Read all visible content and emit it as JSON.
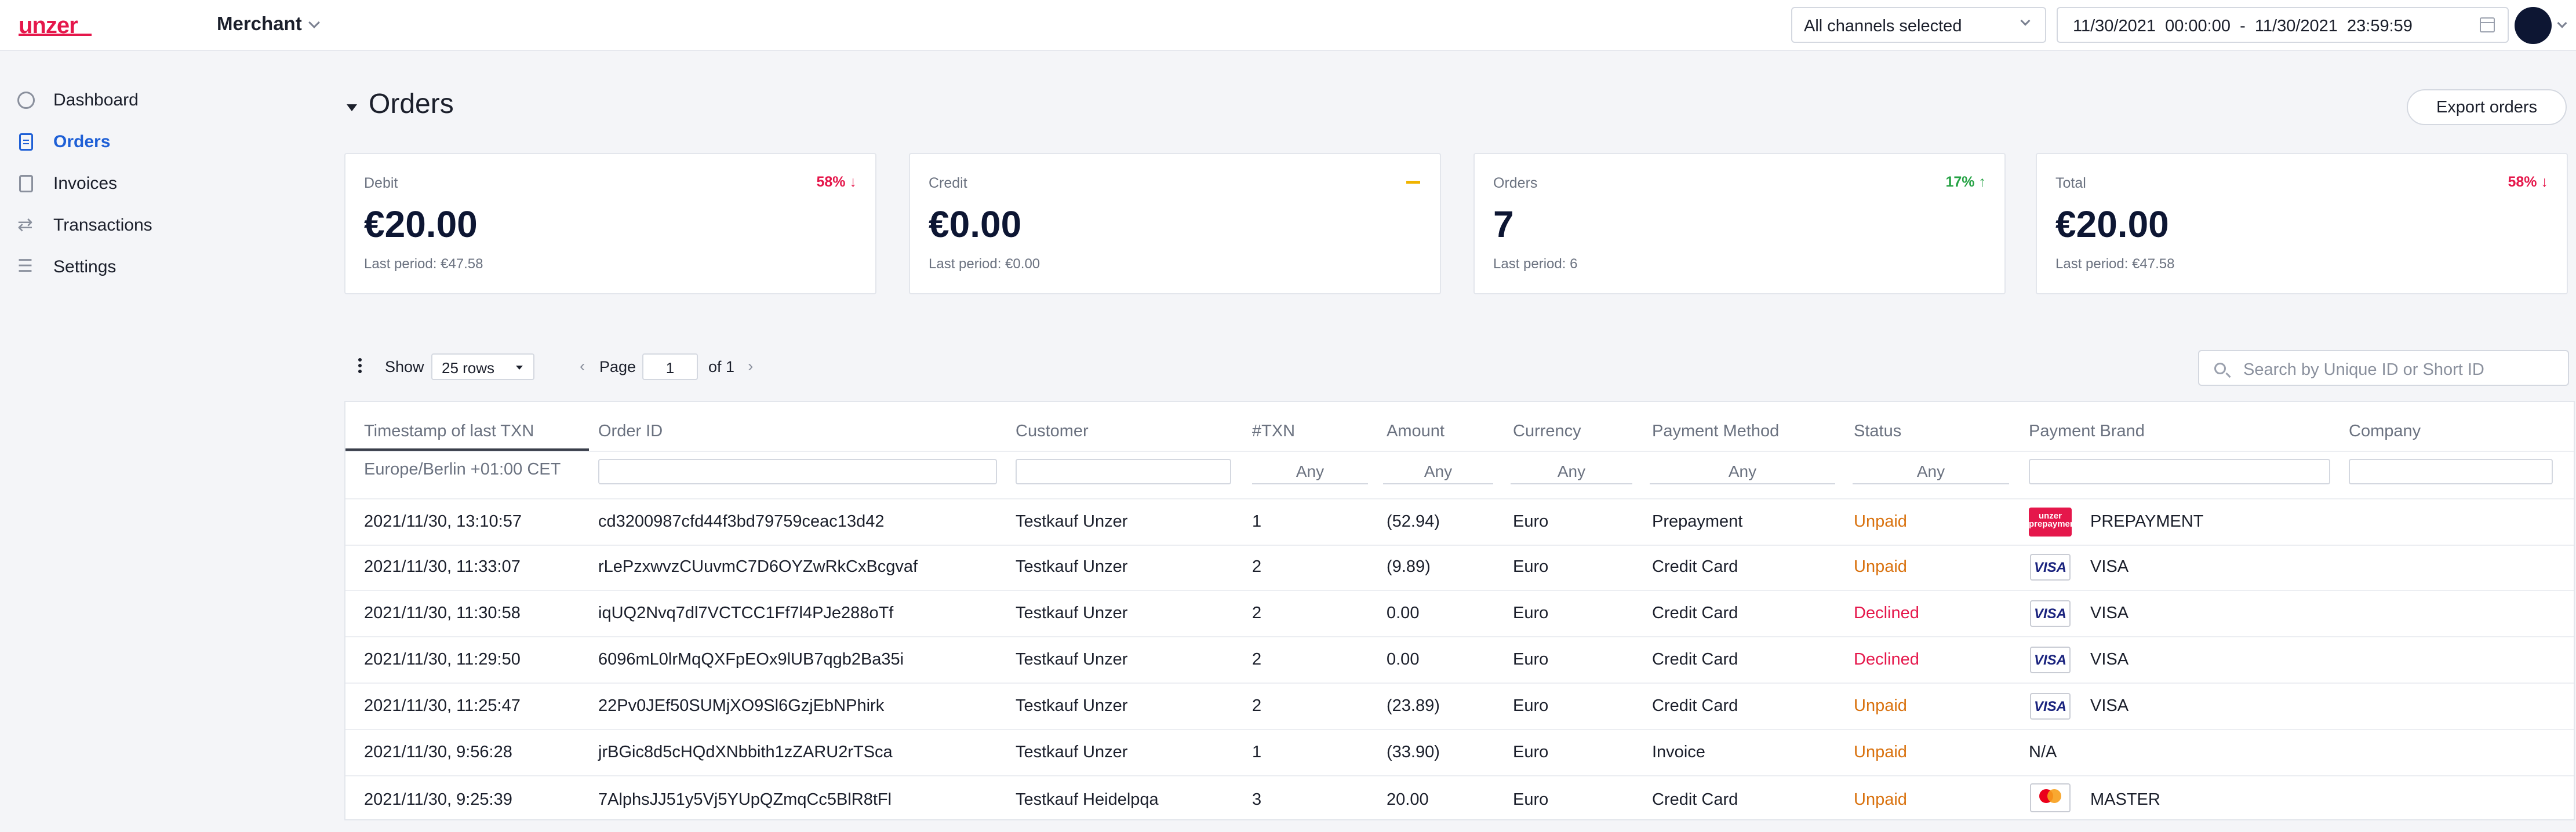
{
  "header": {
    "logo": "unzer",
    "merchant": "Merchant",
    "channels": "All channels selected",
    "date_from": "11/30/2021  00:00:00",
    "date_sep": "-",
    "date_to": "11/30/2021  23:59:59"
  },
  "sidebar": {
    "items": [
      {
        "label": "Dashboard",
        "icon": "dashboard-icon"
      },
      {
        "label": "Orders",
        "icon": "document-icon",
        "active": true
      },
      {
        "label": "Invoices",
        "icon": "invoice-icon"
      },
      {
        "label": "Transactions",
        "icon": "transactions-icon"
      },
      {
        "label": "Settings",
        "icon": "settings-icon"
      }
    ]
  },
  "page": {
    "title": "Orders",
    "export_label": "Export orders"
  },
  "cards": [
    {
      "label": "Debit",
      "value": "€20.00",
      "last": "Last period: €47.58",
      "trend": "58%",
      "direction": "down"
    },
    {
      "label": "Credit",
      "value": "€0.00",
      "last": "Last period: €0.00",
      "trend": "",
      "direction": "flat"
    },
    {
      "label": "Orders",
      "value": "7",
      "last": "Last period: 6",
      "trend": "17%",
      "direction": "up"
    },
    {
      "label": "Total",
      "value": "€20.00",
      "last": "Last period: €47.58",
      "trend": "58%",
      "direction": "down"
    }
  ],
  "toolbar": {
    "show_label": "Show",
    "rows_value": "25 rows",
    "page_label": "Page",
    "page_value": "1",
    "page_of": "of 1",
    "search_placeholder": "Search by Unique ID or Short ID"
  },
  "table": {
    "headers": [
      "Timestamp of last TXN",
      "Order ID",
      "Customer",
      "#TXN",
      "Amount",
      "Currency",
      "Payment Method",
      "Status",
      "Payment Brand",
      "Company"
    ],
    "timezone": "Europe/Berlin +01:00 CET",
    "any_label": "Any",
    "rows": [
      {
        "ts": "2021/11/30, 13:10:57",
        "id": "cd3200987cfd44f3bd79759ceac13d42",
        "customer": "Testkauf Unzer",
        "txn": "1",
        "amount": "(52.94)",
        "currency": "Euro",
        "method": "Prepayment",
        "status": "Unpaid",
        "brand": "PREPAYMENT",
        "brand_logo": "unzer",
        "company": ""
      },
      {
        "ts": "2021/11/30, 11:33:07",
        "id": "rLePzxwvzCUuvmC7D6OYZwRkCxBcgvaf",
        "customer": "Testkauf Unzer",
        "txn": "2",
        "amount": "(9.89)",
        "currency": "Euro",
        "method": "Credit Card",
        "status": "Unpaid",
        "brand": "VISA",
        "brand_logo": "visa",
        "company": ""
      },
      {
        "ts": "2021/11/30, 11:30:58",
        "id": "iqUQ2Nvq7dl7VCTCC1Ff7l4PJe288oTf",
        "customer": "Testkauf Unzer",
        "txn": "2",
        "amount": "0.00",
        "currency": "Euro",
        "method": "Credit Card",
        "status": "Declined",
        "brand": "VISA",
        "brand_logo": "visa",
        "company": ""
      },
      {
        "ts": "2021/11/30, 11:29:50",
        "id": "6096mL0lrMqQXFpEOx9lUB7qgb2Ba35i",
        "customer": "Testkauf Unzer",
        "txn": "2",
        "amount": "0.00",
        "currency": "Euro",
        "method": "Credit Card",
        "status": "Declined",
        "brand": "VISA",
        "brand_logo": "visa",
        "company": ""
      },
      {
        "ts": "2021/11/30, 11:25:47",
        "id": "22Pv0JEf50SUMjXO9Sl6GzjEbNPhirk",
        "customer": "Testkauf Unzer",
        "txn": "2",
        "amount": "(23.89)",
        "currency": "Euro",
        "method": "Credit Card",
        "status": "Unpaid",
        "brand": "VISA",
        "brand_logo": "visa",
        "company": ""
      },
      {
        "ts": "2021/11/30, 9:56:28",
        "id": "jrBGic8d5cHQdXNbbith1zZARU2rTSca",
        "customer": "Testkauf Unzer",
        "txn": "1",
        "amount": "(33.90)",
        "currency": "Euro",
        "method": "Invoice",
        "status": "Unpaid",
        "brand": "N/A",
        "brand_logo": "",
        "company": ""
      },
      {
        "ts": "2021/11/30, 9:25:39",
        "id": "7AlphsJJ51y5Vj5YUpQZmqCc5BlR8tFl",
        "customer": "Testkauf Heidelpqa",
        "txn": "3",
        "amount": "20.00",
        "currency": "Euro",
        "method": "Credit Card",
        "status": "Unpaid",
        "brand": "MASTER",
        "brand_logo": "mastercard",
        "company": ""
      }
    ]
  },
  "colors": {
    "accent": "#e5174b",
    "active_nav": "#1e5fd6",
    "unpaid": "#d9720f",
    "declined": "#e5174b",
    "up": "#25a244"
  }
}
